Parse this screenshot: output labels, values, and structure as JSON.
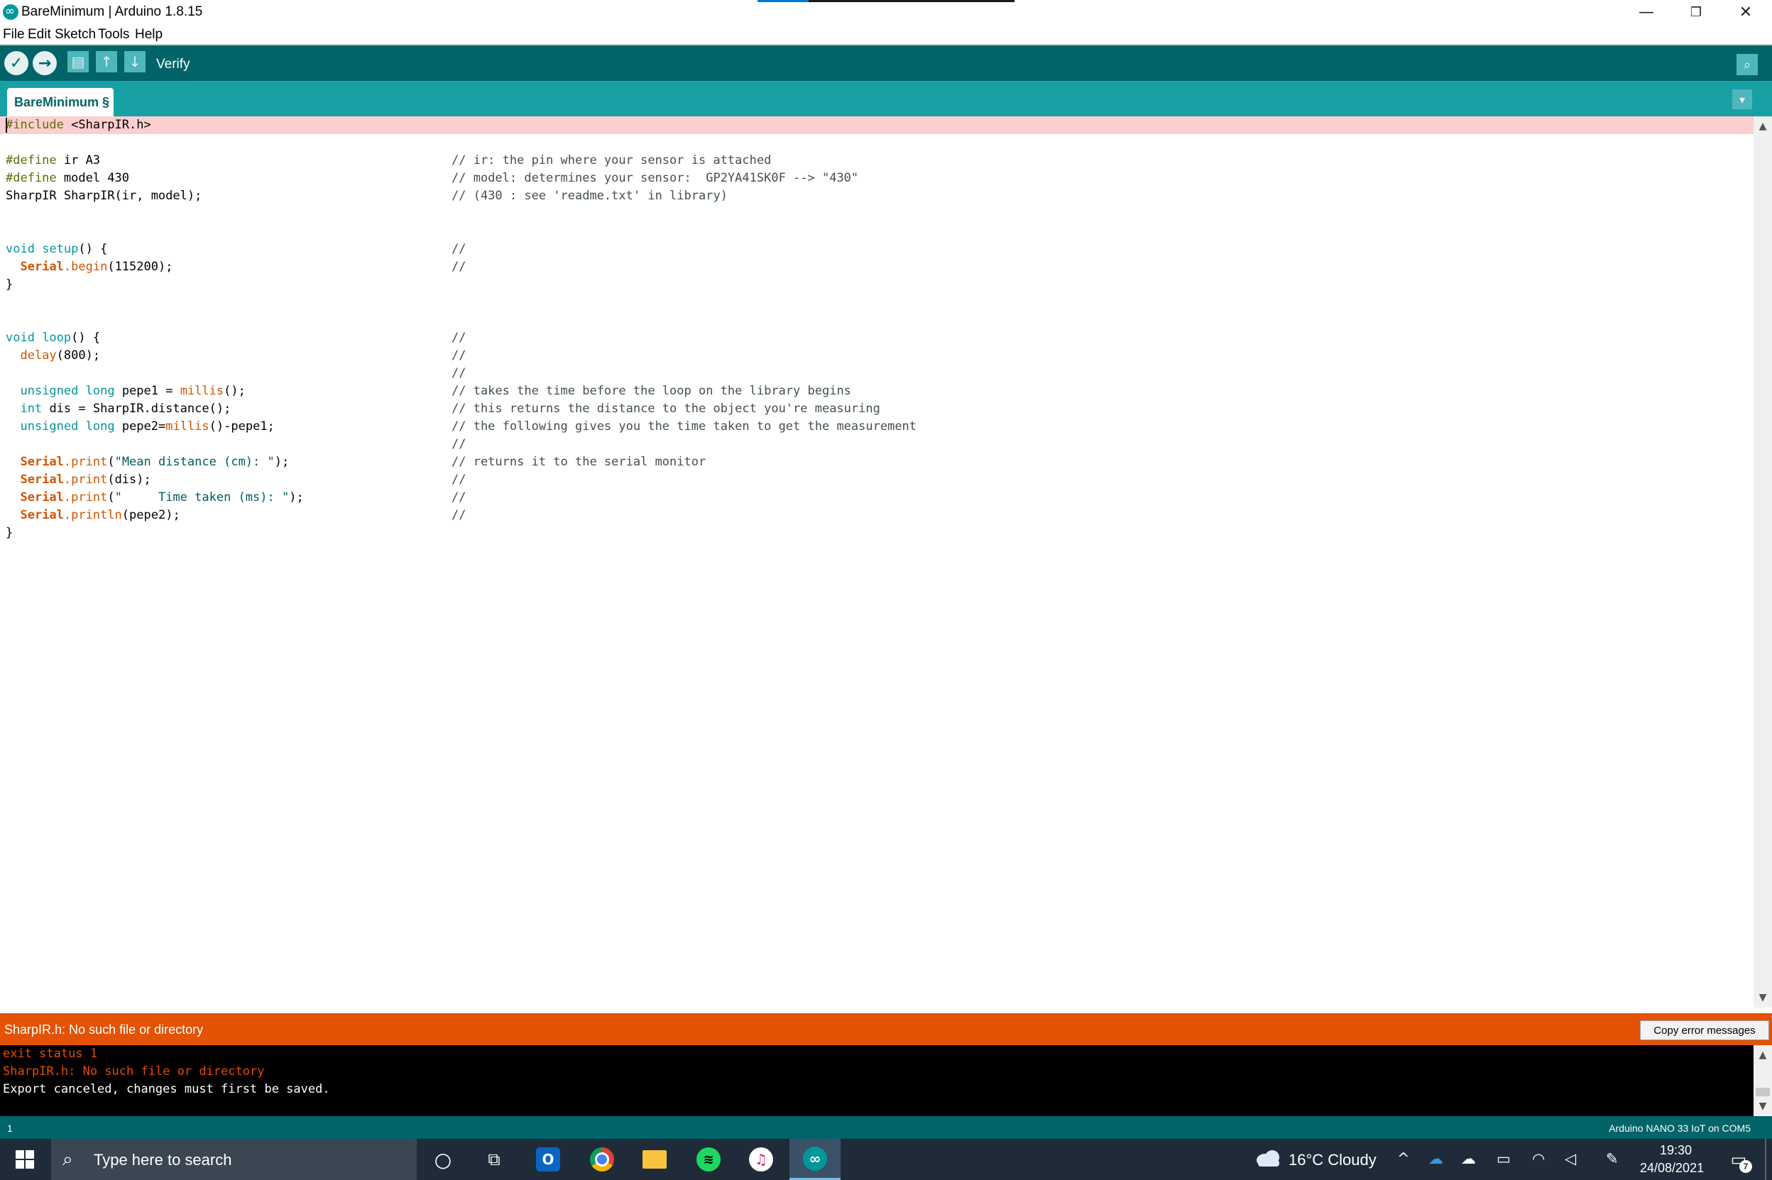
{
  "window": {
    "title": "BareMinimum | Arduino 1.8.15",
    "minimize": "—",
    "restore": "❐",
    "close": "✕"
  },
  "menu": [
    "File",
    "Edit",
    "Sketch",
    "Tools",
    "Help"
  ],
  "toolbar": {
    "status": "Verify",
    "buttons": {
      "verify": "✓",
      "upload": "→",
      "new": "📄",
      "open": "↑",
      "save": "↓",
      "serial_monitor": "⌕"
    }
  },
  "tab": {
    "label": "BareMinimum §",
    "menu_arrow": "▾"
  },
  "editor": {
    "line1_pp": "#include",
    "line1_rest": " <SharpIR.h>",
    "code": {
      "d1_pp": "#define",
      "d1_rest": " ir A3",
      "d2_pp": "#define",
      "d2_rest": " model 430",
      "obj": "SharpIR SharpIR(ir, model);",
      "setup_kw": "void",
      "setup_fn": " setup",
      "setup_rest": "() {",
      "serial": "Serial",
      "begin": ".begin",
      "begin_args": "(115200);",
      "close": "}",
      "loop_kw": "void",
      "loop_fn": " loop",
      "loop_rest": "() {",
      "delay_fn": "delay",
      "delay_args": "(800);",
      "unsigned": "unsigned",
      "long": "long",
      "pepe1_rest": " pepe1 = ",
      "millis": "millis",
      "call_end": "();",
      "int_kw": "int",
      "dis_rest": " dis = SharpIR.distance();",
      "pepe2_rest": " pepe2=",
      "pepe2_tail": "()-pepe1;",
      "print": ".print",
      "println": ".println",
      "print1_open": "(",
      "print1_str": "\"Mean distance (cm): \"",
      "print1_close": ");",
      "print2_args": "(dis);",
      "print3_str": "\"     Time taken (ms): \"",
      "print4_args": "(pepe2);"
    },
    "comments": {
      "c1": "// ir: the pin where your sensor is attached",
      "c2": "// model: determines your sensor:  GP2YA41SK0F --> \"430\"",
      "c3": "// (430 : see 'readme.txt' in library)",
      "empty": "//",
      "c_takes": "// takes the time before the loop on the library begins",
      "c_returns": "// this returns the distance to the object you're measuring",
      "c_following": "// the following gives you the time taken to get the measurement",
      "c_serial": "// returns it to the serial monitor"
    }
  },
  "error_bar": {
    "message": "SharpIR.h: No such file or directory",
    "copy_button": "Copy error messages"
  },
  "console": {
    "lines": [
      {
        "text": "exit status 1",
        "color": "#e34c00"
      },
      {
        "text": "SharpIR.h: No such file or directory",
        "color": "#e34c00"
      },
      {
        "text": "Export canceled, changes must first be saved.",
        "color": "#ffffff"
      }
    ]
  },
  "status_bar": {
    "line_number": "1",
    "board": "Arduino NANO 33 IoT on COM5"
  },
  "taskbar": {
    "search_placeholder": "Type here to search",
    "weather": "16°C  Cloudy",
    "time": "19:30",
    "date": "24/08/2021",
    "notifications": "7"
  },
  "colors": {
    "arduino_dark": "#006468",
    "arduino_teal": "#17a1a5",
    "error_orange": "#e35205",
    "error_line": "#fbcfd0"
  }
}
